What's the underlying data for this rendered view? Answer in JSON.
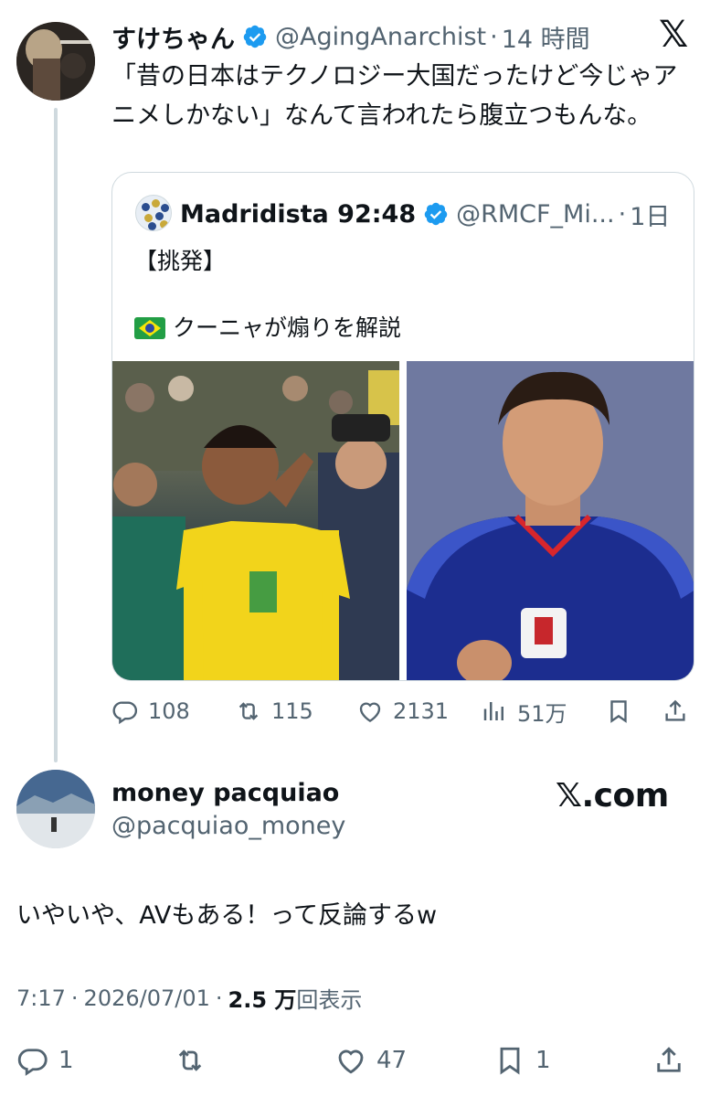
{
  "parent": {
    "name": "すけちゃん",
    "handle": "@AgingAnarchist",
    "separator": "·",
    "time": "14 時間",
    "text": "「昔の日本はテクノロジー大国だったけど今じゃアニメしかない」なんて言われたら腹立つもんな。",
    "x_logo": "𝕏"
  },
  "quote": {
    "name": "Madridista 92:48",
    "handle": "@RMCF_Mi...",
    "separator": "·",
    "time": "1日",
    "line1": "【挑発】",
    "line2": "クーニャが煽りを解説",
    "flag": "brazil-flag-icon"
  },
  "parent_actions": {
    "replies": "108",
    "retweets": "115",
    "likes": "2131",
    "views": "51万"
  },
  "reply": {
    "name": "money pacquiao",
    "handle": "@pacquiao_money",
    "xcom": "𝕏.com",
    "text": "いやいや、AVもある！って反論するw",
    "time": "7:17",
    "sep1": "·",
    "date": "2026/07/01",
    "sep2": "·",
    "views_count": "2.5 万",
    "views_label": "回表示"
  },
  "reply_actions": {
    "replies": "1",
    "likes": "47",
    "bookmarks": "1"
  },
  "colors": {
    "text": "#0f1419",
    "muted": "#536471",
    "border": "#cfd9de",
    "verified": "#1d9bf0"
  }
}
